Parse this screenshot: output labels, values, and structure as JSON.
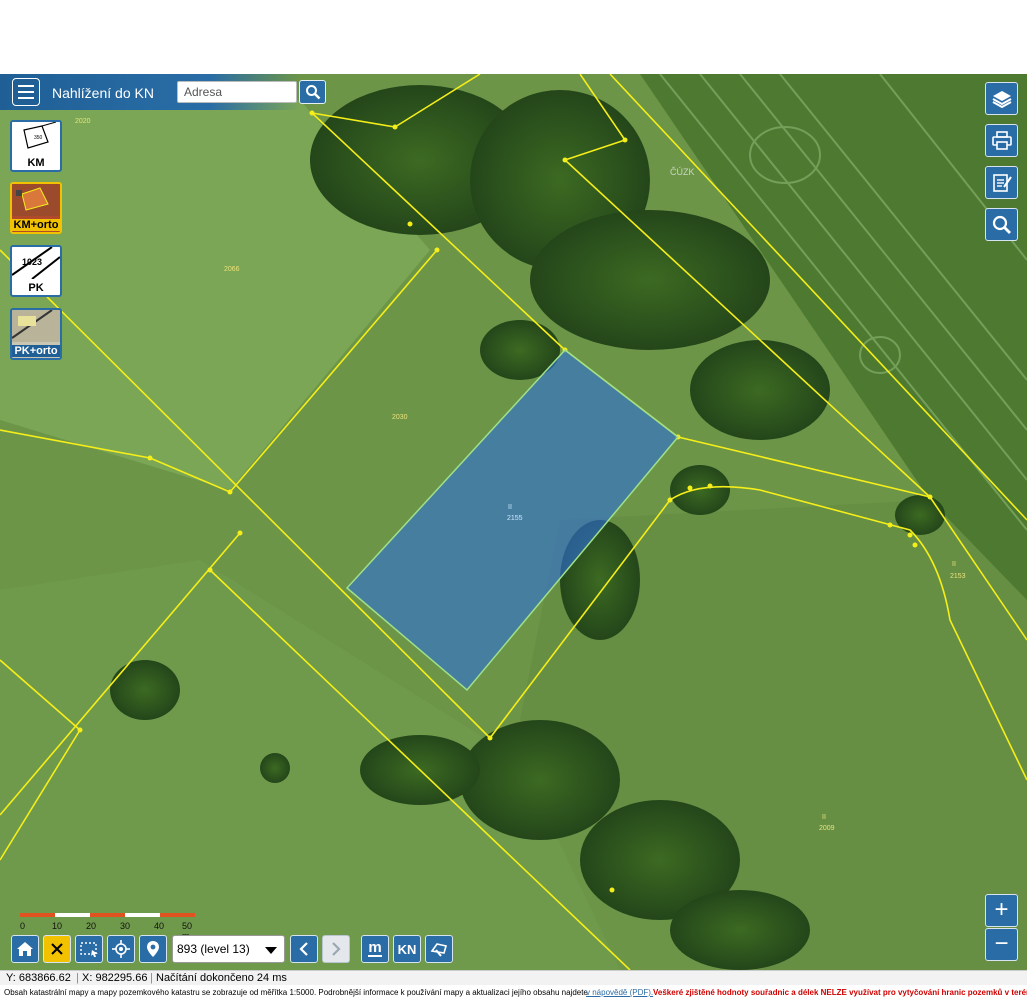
{
  "header": {
    "app_title": "Nahlížení do KN",
    "search_placeholder": "Adresa"
  },
  "map_types": [
    {
      "label": "KM",
      "active": false
    },
    {
      "label": "KM+orto",
      "active": true
    },
    {
      "label": "PK",
      "active": false
    },
    {
      "label": "PK+orto",
      "active": false
    }
  ],
  "map_labels": {
    "locality": "ČÚZK",
    "parcels": [
      "2020",
      "2066",
      "2030",
      "2155",
      "2153",
      "2009",
      "350"
    ],
    "symbol": "II",
    "pk_thumb": "1023"
  },
  "right_tools": [
    "layers-icon",
    "print-icon",
    "notes-icon",
    "search-icon"
  ],
  "zoom": {
    "in": "+",
    "out": "−"
  },
  "scale": {
    "labels": [
      "0",
      "10",
      "20",
      "30",
      "40",
      "50 m"
    ]
  },
  "toolbar": {
    "level_value": "893 (level 13)",
    "kn_label": "KN",
    "m_label": "m"
  },
  "status": {
    "y_coord": "Y: 683866.62",
    "x_coord": "X: 982295.66",
    "loading": "Načítání dokončeno 24 ms"
  },
  "info": {
    "text": "Obsah katastrální mapy a mapy pozemkového katastru se zobrazuje od měřítka 1:5000. Podrobnější informace k používání mapy a aktualizaci jejího obsahu najdete",
    "link": "v nápovědě (PDF).",
    "warning": "Veškeré zjištěné hodnoty souřadnic a délek NELZE využívat pro vytyčování hranic pozemků v terénu."
  },
  "colors": {
    "accent": "#2a6da6",
    "parcel_line": "#f5ee1a",
    "selected_fill": "#2f6fd6",
    "warning": "#d00000"
  }
}
